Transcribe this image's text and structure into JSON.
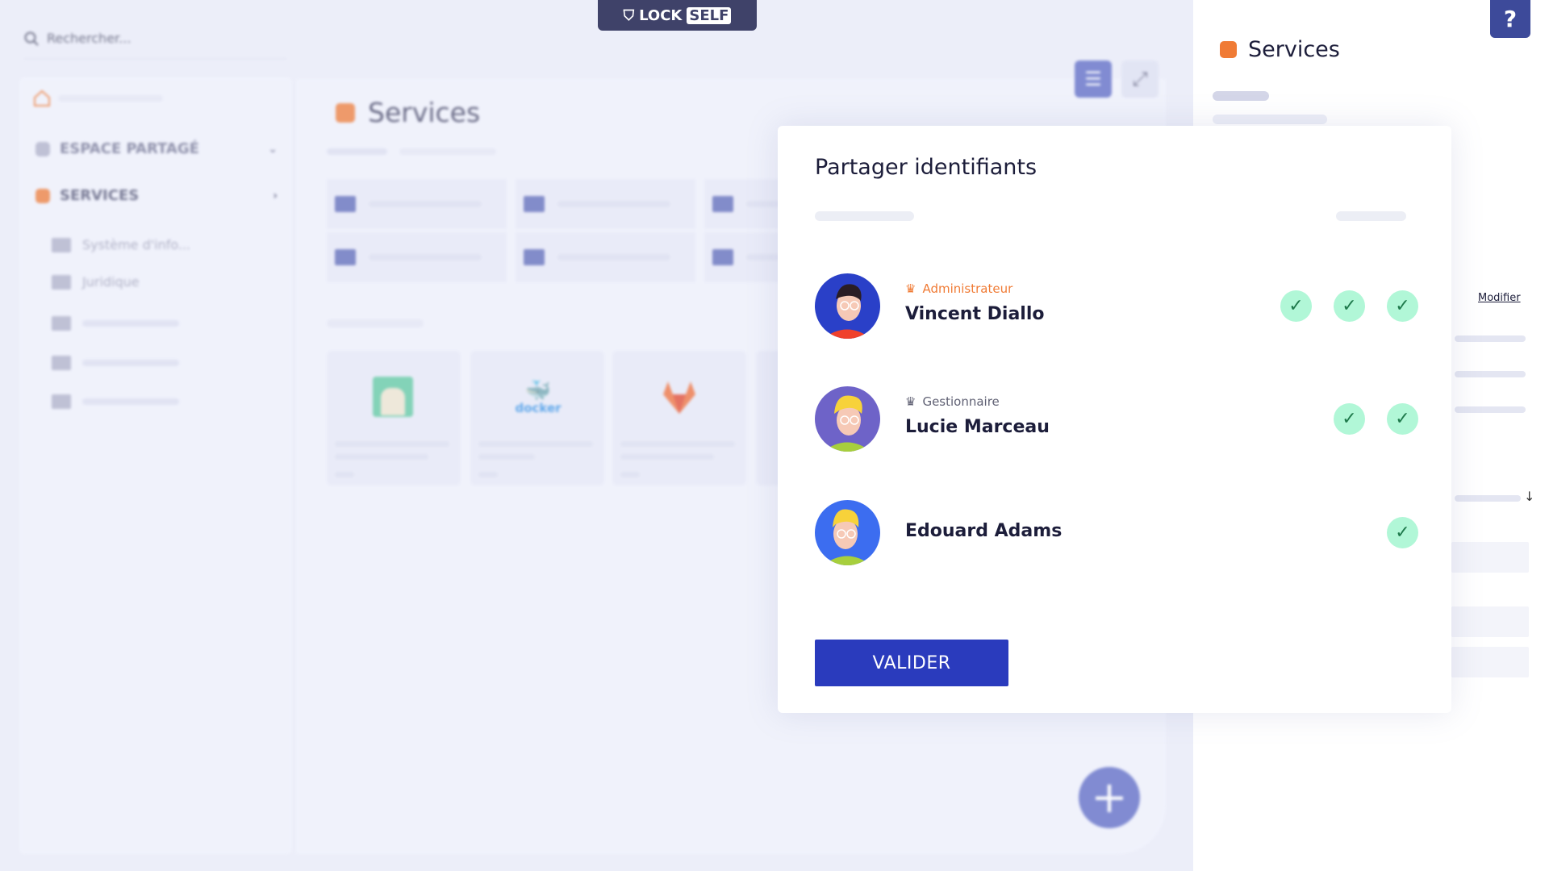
{
  "header": {
    "search_placeholder": "Rechercher...",
    "logo": "LOCKSELF",
    "logo_lock": "LOCK",
    "logo_self": "SELF"
  },
  "sidebar": {
    "items": [
      {
        "label": "ESPACE PARTAGÉ",
        "color": "#aeb0c8"
      },
      {
        "label": "SERVICES",
        "color": "#f07b35"
      }
    ],
    "sub_items": [
      {
        "label": "Système d'info..."
      },
      {
        "label": "Juridique"
      },
      {
        "label": ""
      },
      {
        "label": ""
      },
      {
        "label": ""
      }
    ]
  },
  "main": {
    "title": "Services",
    "apps": [
      "",
      "docker",
      ""
    ]
  },
  "right_panel": {
    "title": "Services",
    "modify_link": "Modifier"
  },
  "modal": {
    "title": "Partager identifiants",
    "users": [
      {
        "name": "Vincent Diallo",
        "role": "Administrateur",
        "role_color": "#f07b35",
        "checks": 3,
        "avatar_bg": "#2a40c8"
      },
      {
        "name": "Lucie Marceau",
        "role": "Gestionnaire",
        "role_color": "#5f6073",
        "checks": 2,
        "avatar_bg": "#6e63c8"
      },
      {
        "name": "Edouard Adams",
        "role": "",
        "checks": 1,
        "avatar_bg": "#3c6df0"
      }
    ],
    "submit_label": "VALIDER"
  },
  "colors": {
    "accent": "#2a3bbd",
    "orange": "#f07b35",
    "check_bg": "#b1f7d7"
  }
}
